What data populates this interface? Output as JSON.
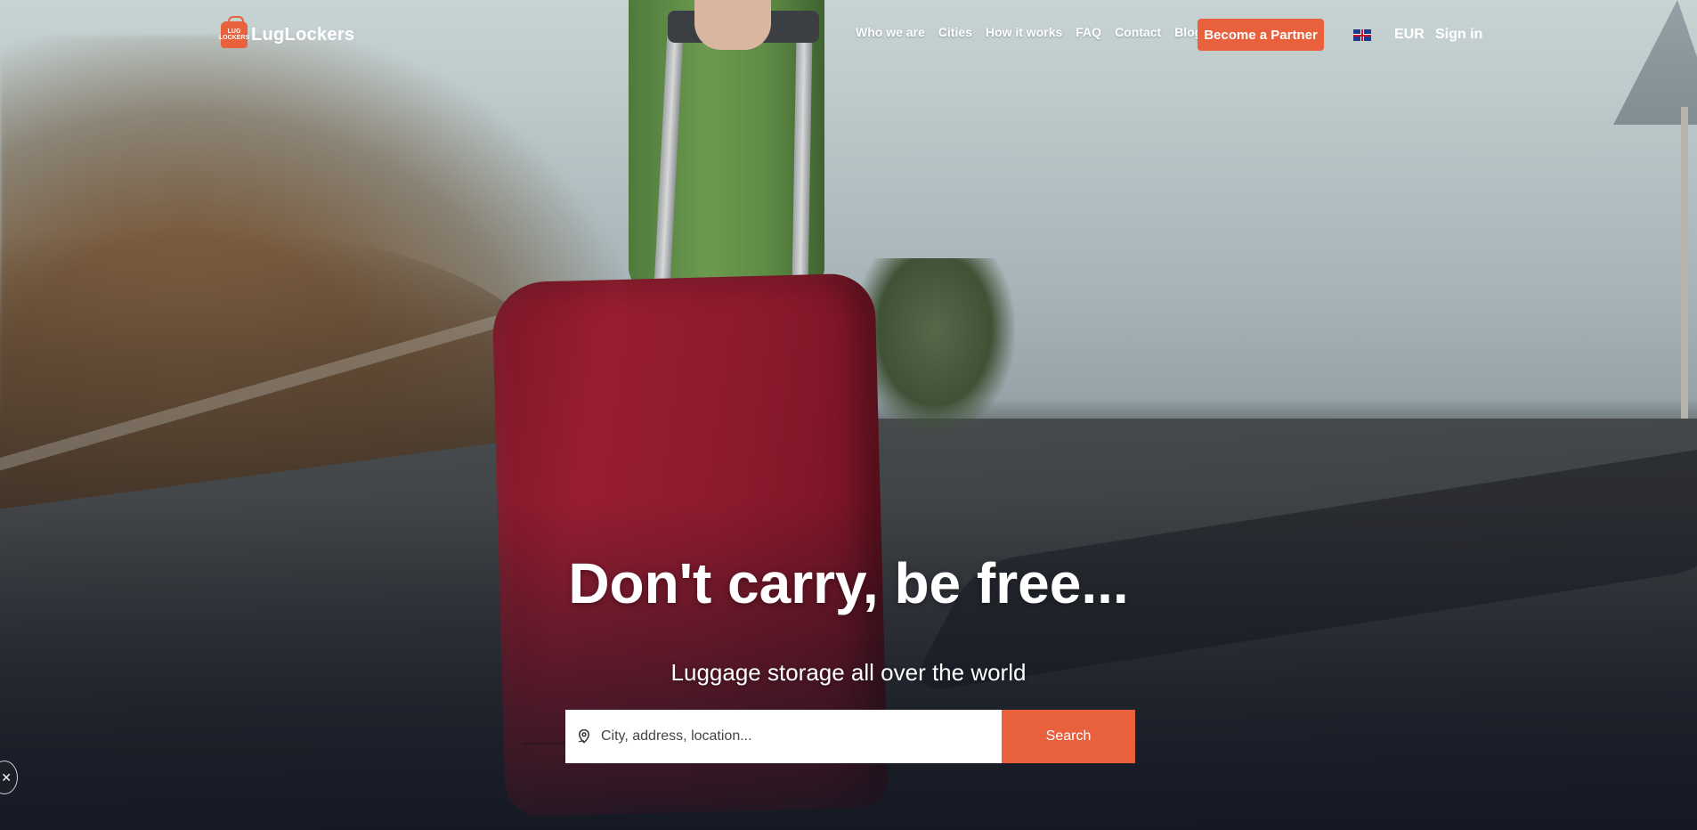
{
  "header": {
    "logo_text": "LugLockers",
    "logo_mark_text": "LUG LOCKERS",
    "nav": [
      {
        "label": "Who we are"
      },
      {
        "label": "Cities"
      },
      {
        "label": "How it works"
      },
      {
        "label": "FAQ"
      },
      {
        "label": "Contact"
      },
      {
        "label": "Blog"
      }
    ],
    "partner_label": "Become a Partner",
    "language_icon": "uk-flag-icon",
    "currency": "EUR",
    "signin_label": "Sign in"
  },
  "hero": {
    "headline": "Don't carry, be free...",
    "subline": "Luggage storage all over the world",
    "search": {
      "placeholder": "City, address, location...",
      "button_label": "Search",
      "icon": "location-pin-icon"
    }
  },
  "widget": {
    "close_glyph": "✕",
    "icon": "close-icon"
  },
  "colors": {
    "accent": "#e8603c",
    "text": "#ffffff"
  }
}
